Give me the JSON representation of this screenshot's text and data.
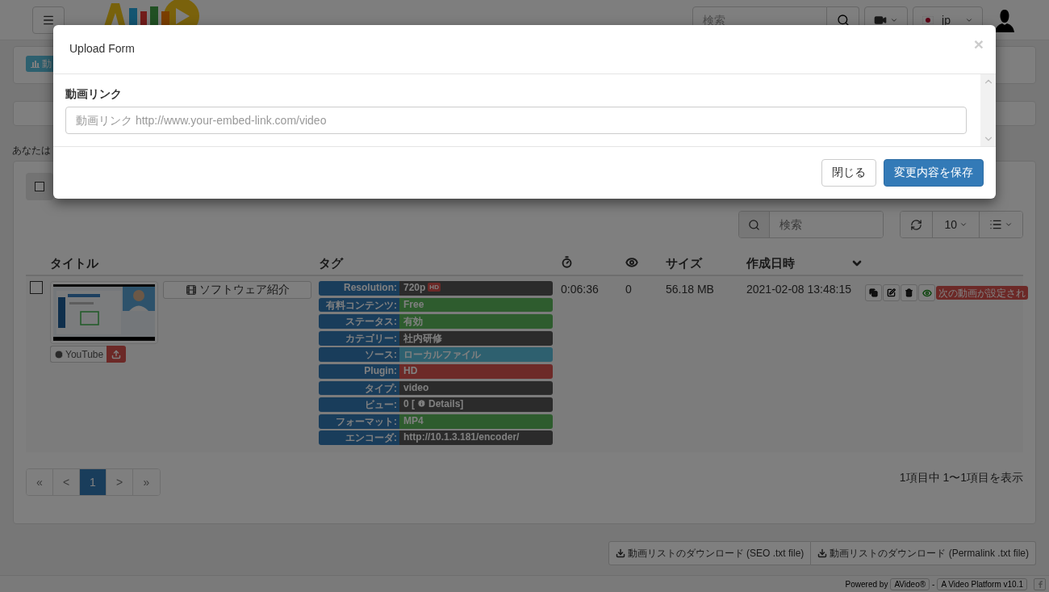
{
  "header": {
    "search_placeholder": "検索",
    "language": "jp"
  },
  "top_panel": {
    "button": "動"
  },
  "notice": "あなたは",
  "toolbar": {
    "select_all_checked": false
  },
  "table_search": {
    "placeholder": "検索"
  },
  "page_size": "10",
  "columns": {
    "title": "タイトル",
    "tags": "タグ",
    "size": "サイズ",
    "created": "作成日時"
  },
  "rows": [
    {
      "checked": false,
      "title": "ソフトウェア紹介",
      "source": "YouTube",
      "duration": "0:06:36",
      "views": "0",
      "size": "56.18 MB",
      "created": "2021-02-08 13:48:15",
      "status": "次の動画が設定され",
      "tags": [
        {
          "label": "Resolution:",
          "value": "720p",
          "badge": "HD",
          "color": "#2b2b2b"
        },
        {
          "label": "有料コンテンツ:",
          "value": "Free",
          "color": "#2e5c2e"
        },
        {
          "label": "ステータス:",
          "value": "有効",
          "color": "#2e5c2e"
        },
        {
          "label": "カテゴリー:",
          "value": "社内研修",
          "color": "#2b2b2b"
        },
        {
          "label": "ソース:",
          "value": "ローカルファイル",
          "color": "#2e606f"
        },
        {
          "label": "Plugin:",
          "value": "HD",
          "color": "#6d2a28"
        },
        {
          "label": "タイプ:",
          "value": "video",
          "color": "#2b2b2b"
        },
        {
          "label": "ビュー:",
          "value": "0 [",
          "link": "Details]",
          "color": "#2b2b2b"
        },
        {
          "label": "フォーマット:",
          "value": "MP4",
          "color": "#2e5c2e"
        },
        {
          "label": "エンコーダ:",
          "value": "http://10.1.3.181/encoder/",
          "color": "#2b2b2b"
        }
      ]
    }
  ],
  "pagination": [
    {
      "label": "«",
      "selected": false
    },
    {
      "label": "<",
      "selected": false
    },
    {
      "label": "1",
      "selected": true
    },
    {
      "label": ">",
      "selected": false
    },
    {
      "label": "»",
      "selected": false
    }
  ],
  "summary": "1項目中 1〜1項目を表示",
  "downloads": [
    "動画リストのダウンロード (SEO .txt file)",
    "動画リストのダウンロード (Permalink .txt file)"
  ],
  "footer": {
    "powered_by": "Powered by",
    "product": "AVideo®",
    "separator": "-",
    "platform": "A Video Platform v10.1"
  },
  "modal": {
    "title": "Upload Form",
    "close": "×",
    "field_label": "動画リンク",
    "placeholder": "動画リンク http://www.your-embed-link.com/video",
    "buttons": [
      "閉じる",
      "変更内容を保存"
    ]
  }
}
